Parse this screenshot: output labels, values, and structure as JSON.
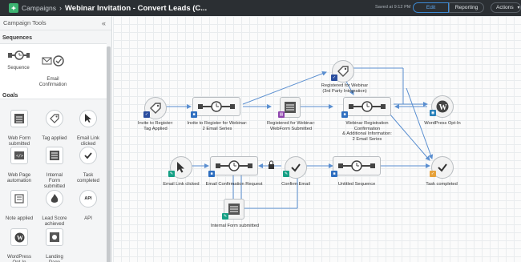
{
  "header": {
    "crumb": "Campaigns",
    "separator": "›",
    "title": "Webinar Invitation - Convert Leads (C...",
    "saved": "Saved at 9:12 PM",
    "tabs": [
      "Edit",
      "Reporting"
    ],
    "actions": "Actions",
    "actions_caret": "▾"
  },
  "sidebar": {
    "title": "Campaign Tools",
    "collapse": "«",
    "sections": {
      "sequences": "Sequences",
      "goals": "Goals"
    },
    "sequences": [
      {
        "label": "Sequence"
      },
      {
        "label": "Email\nConfirmation"
      }
    ],
    "goals": [
      {
        "label": "Web Form\nsubmitted"
      },
      {
        "label": "Tag applied"
      },
      {
        "label": "Email Link\nclicked"
      },
      {
        "label": "Web Page\nautomation"
      },
      {
        "label": "Internal\nForm\nsubmitted"
      },
      {
        "label": "Task\ncompleted"
      },
      {
        "label": "Note applied"
      },
      {
        "label": "Lead Score\nachieved"
      },
      {
        "label": "API",
        "icon_text": "API"
      },
      {
        "label": "WordPress\nOpt-In"
      },
      {
        "label": "Landing\nPage\nsubmitted"
      }
    ]
  },
  "canvas": {
    "nodes": {
      "tag_applied": "Invite to Register:\nTag Applied",
      "invite_series": "Invite to Register for Webinar:\n2 Email Series",
      "registered_webform": "Registered for Webinar:\nWebForm Submitted",
      "registered_3rd": "Registered for Webinar\n(3rd Party Integration)",
      "confirmation_series": "Webinar Registration Confirmation\n& Additional  Information:\n2 Email Series",
      "wordpress_optin": "WordPress Opt-In",
      "email_link_clicked": "Email Link clicked",
      "email_confirmation_request": "Email Confirmation Request",
      "confirm_email": "Confirm Email",
      "untitled_sequence": "Untitled Sequence",
      "task_completed": "Task completed",
      "internal_form": "Internal Form submitted"
    }
  },
  "colors": {
    "topbar": "#2b2f33",
    "accent": "#3d8bd6",
    "connector": "#5b8fd0"
  }
}
